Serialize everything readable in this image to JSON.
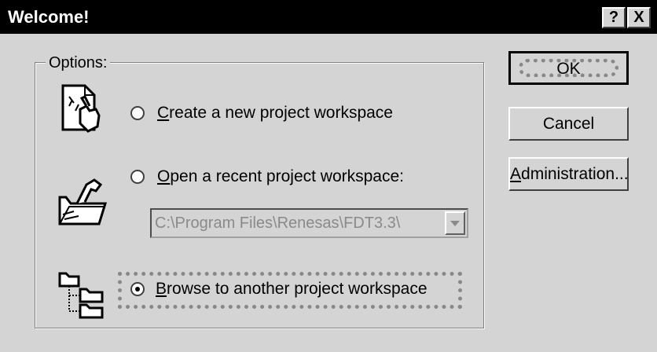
{
  "window": {
    "title": "Welcome!",
    "help_button": "?",
    "close_button": "X"
  },
  "options_group": {
    "label": "Options:",
    "radios": [
      {
        "prefix": "C",
        "rest": "reate a new project workspace",
        "checked": false,
        "icon": "new-document-hand-icon"
      },
      {
        "prefix": "O",
        "rest": "pen a recent project workspace:",
        "checked": false,
        "icon": "open-folder-hand-icon"
      },
      {
        "prefix": "B",
        "rest": "rowse to another project workspace",
        "checked": true,
        "icon": "folder-tree-icon"
      }
    ],
    "recent_path": "C:\\Program Files\\Renesas\\FDT3.3\\"
  },
  "buttons": {
    "ok": "OK",
    "cancel": "Cancel",
    "administration_prefix": "A",
    "administration_rest": "dministration..."
  }
}
